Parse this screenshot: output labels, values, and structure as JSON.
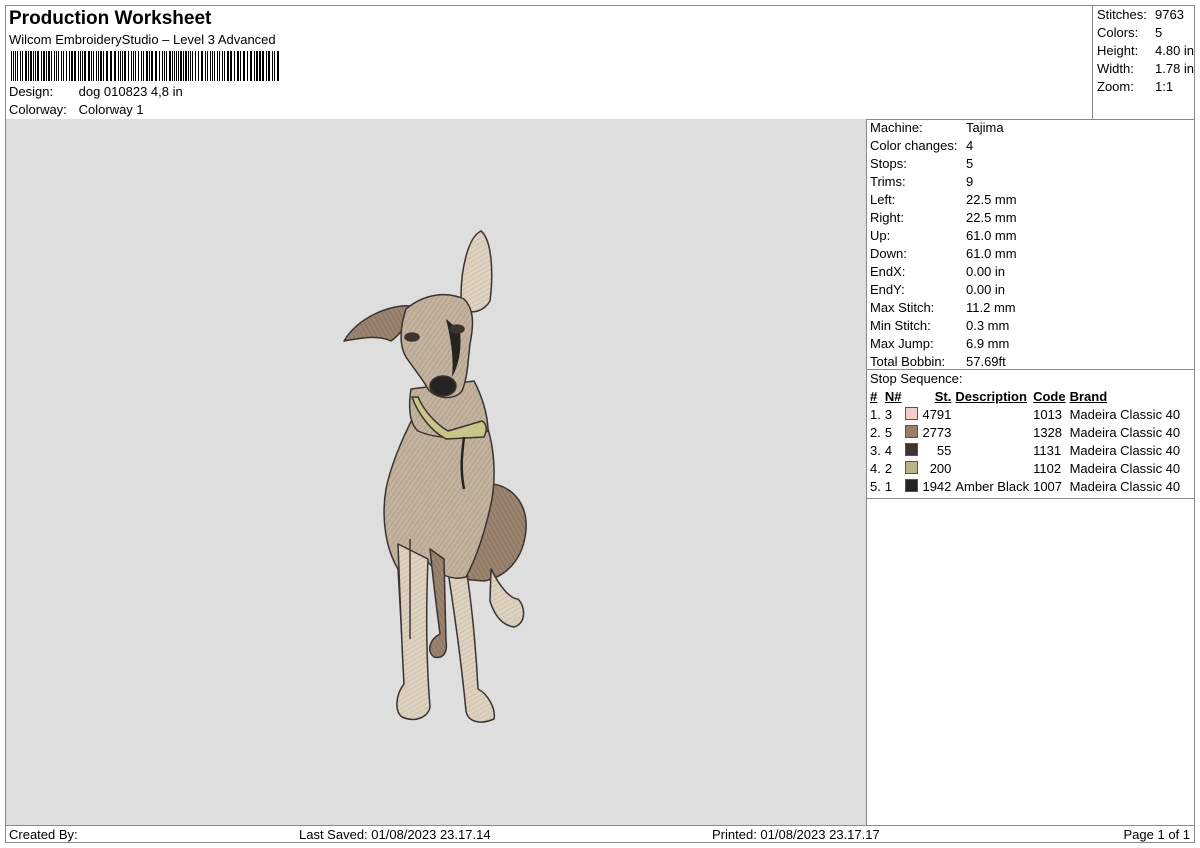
{
  "header": {
    "title": "Production Worksheet",
    "subtitle": "Wilcom EmbroideryStudio – Level 3 Advanced",
    "barcode_icon": "barcode-icon",
    "design_label": "Design:",
    "design_value": "dog 010823 4,8 in",
    "colorway_label": "Colorway:",
    "colorway_value": "Colorway 1"
  },
  "stats": {
    "stitches_label": "Stitches:",
    "stitches": "9763",
    "colors_label": "Colors:",
    "colors": "5",
    "height_label": "Height:",
    "height": "4.80 in",
    "width_label": "Width:",
    "width": "1.78 in",
    "zoom_label": "Zoom:",
    "zoom": "1:1"
  },
  "machine_info": [
    {
      "label": "Machine:",
      "value": "Tajima"
    },
    {
      "label": "Color changes:",
      "value": "4"
    },
    {
      "label": "Stops:",
      "value": "5"
    },
    {
      "label": "Trims:",
      "value": "9"
    },
    {
      "label": "Left:",
      "value": "22.5 mm"
    },
    {
      "label": "Right:",
      "value": "22.5 mm"
    },
    {
      "label": "Up:",
      "value": "61.0 mm"
    },
    {
      "label": "Down:",
      "value": "61.0 mm"
    },
    {
      "label": "EndX:",
      "value": "0.00 in"
    },
    {
      "label": "EndY:",
      "value": "0.00 in"
    },
    {
      "label": "Max Stitch:",
      "value": "11.2 mm"
    },
    {
      "label": "Min Stitch:",
      "value": "0.3 mm"
    },
    {
      "label": "Max Jump:",
      "value": "6.9 mm"
    },
    {
      "label": "Total Bobbin:",
      "value": "57.69ft"
    }
  ],
  "stop_sequence": {
    "title": "Stop Sequence:",
    "headers": {
      "num": "#",
      "n": "N#",
      "st": "St.",
      "description": "Description",
      "code": "Code",
      "brand": "Brand"
    },
    "rows": [
      {
        "num": "1.",
        "n": "3",
        "color": "#f3cfcc",
        "st": "4791",
        "description": "",
        "code": "1013",
        "brand": "Madeira Classic 40"
      },
      {
        "num": "2.",
        "n": "5",
        "color": "#9b7d6c",
        "st": "2773",
        "description": "",
        "code": "1328",
        "brand": "Madeira Classic 40"
      },
      {
        "num": "3.",
        "n": "4",
        "color": "#3e3532",
        "st": "55",
        "description": "",
        "code": "1131",
        "brand": "Madeira Classic 40"
      },
      {
        "num": "4.",
        "n": "2",
        "color": "#b9b387",
        "st": "200",
        "description": "",
        "code": "1102",
        "brand": "Madeira Classic 40"
      },
      {
        "num": "5.",
        "n": "1",
        "color": "#262422",
        "st": "1942",
        "description": "Amber Black",
        "code": "1007",
        "brand": "Madeira Classic 40"
      }
    ]
  },
  "preview": {
    "background": "#dedede",
    "fur_color": "#bfae9a",
    "dark_fur_color": "#8f7a66",
    "outline_color": "#3a3330",
    "collar_color": "#c9c58a"
  },
  "footer": {
    "created_by": "Created By:",
    "last_saved": "Last Saved: 01/08/2023 23.17.14",
    "printed": "Printed: 01/08/2023 23.17.17",
    "page": "Page 1 of 1"
  }
}
